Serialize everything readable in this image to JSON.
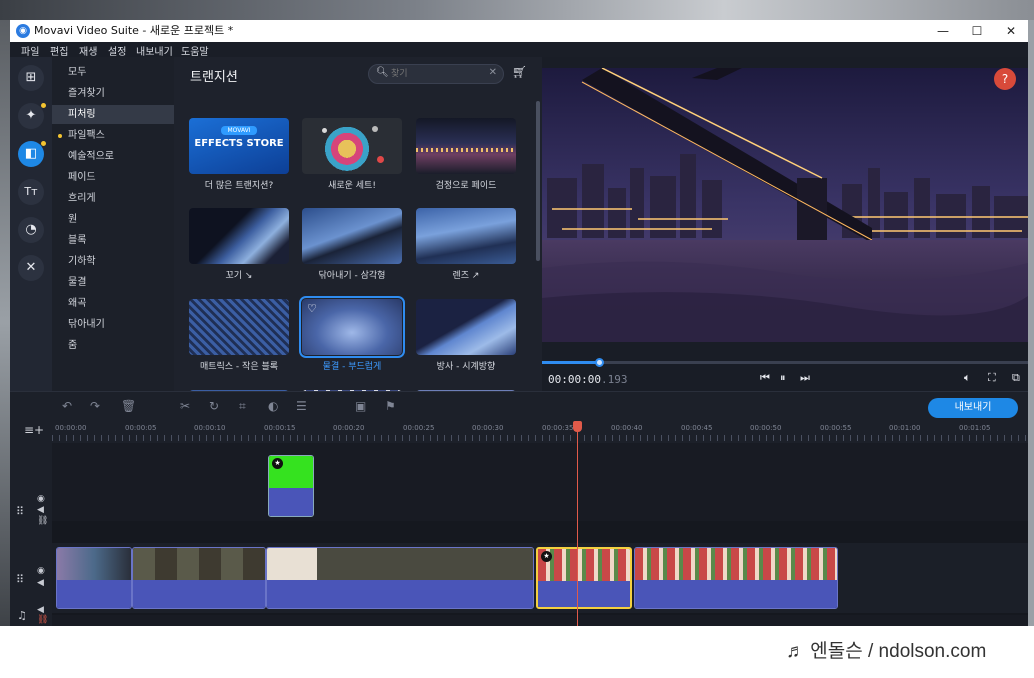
{
  "window": {
    "title": "Movavi Video Suite - 새로운 프로젝트 *",
    "minimize": "—",
    "maximize": "☐",
    "close": "✕"
  },
  "menu": [
    "파일",
    "편집",
    "재생",
    "설정",
    "내보내기",
    "도움말"
  ],
  "tools": [
    {
      "name": "import-icon",
      "glyph": "+"
    },
    {
      "name": "magic-wand-icon",
      "glyph": "✦"
    },
    {
      "name": "transitions-icon",
      "glyph": "◧"
    },
    {
      "name": "titles-icon",
      "glyph": "Tт"
    },
    {
      "name": "stickers-icon",
      "glyph": "◔"
    },
    {
      "name": "tools-icon",
      "glyph": "✕"
    }
  ],
  "categories": [
    "모두",
    "즐겨찾기",
    "피처링",
    "파일팩스",
    "예술적으로",
    "페이드",
    "흐리게",
    "원",
    "블록",
    "기하학",
    "물결",
    "왜곡",
    "닦아내기",
    "줌"
  ],
  "transitions": {
    "title": "트랜지션",
    "search_placeholder": "찾기",
    "items": [
      {
        "label": "더 많은 트랜지션?",
        "store_badge": "MOVAVI",
        "store_text": "EFFECTS STORE"
      },
      {
        "label": "새로운 세트!"
      },
      {
        "label": "검정으로 페이드"
      },
      {
        "label": "꼬기 ↘"
      },
      {
        "label": "닦아내기 - 삼각형"
      },
      {
        "label": "렌즈 ↗"
      },
      {
        "label": "매트릭스 - 작은 블록"
      },
      {
        "label": "물결 - 부드럽게"
      },
      {
        "label": "방사 - 시계방향"
      }
    ]
  },
  "preview": {
    "help": "?",
    "time_main": "00:00:00",
    "time_ms": ".193",
    "progress": 0.12
  },
  "timeline": {
    "export_label": "내보내기",
    "ruler": [
      "00:00:00",
      "00:00:05",
      "00:00:10",
      "00:00:15",
      "00:00:20",
      "00:00:25",
      "00:00:30",
      "00:00:35",
      "00:00:40",
      "00:00:45",
      "00:00:50",
      "00:00:55",
      "00:01:00",
      "00:01:05"
    ]
  },
  "footer": {
    "watermark": "♬ 엔돌슨 / ndolson.com"
  },
  "colors": {
    "accent": "#1e88e5",
    "playhead": "#e05a4a",
    "selected_clip": "#f4d03f",
    "green_clip": "#35e21f"
  }
}
